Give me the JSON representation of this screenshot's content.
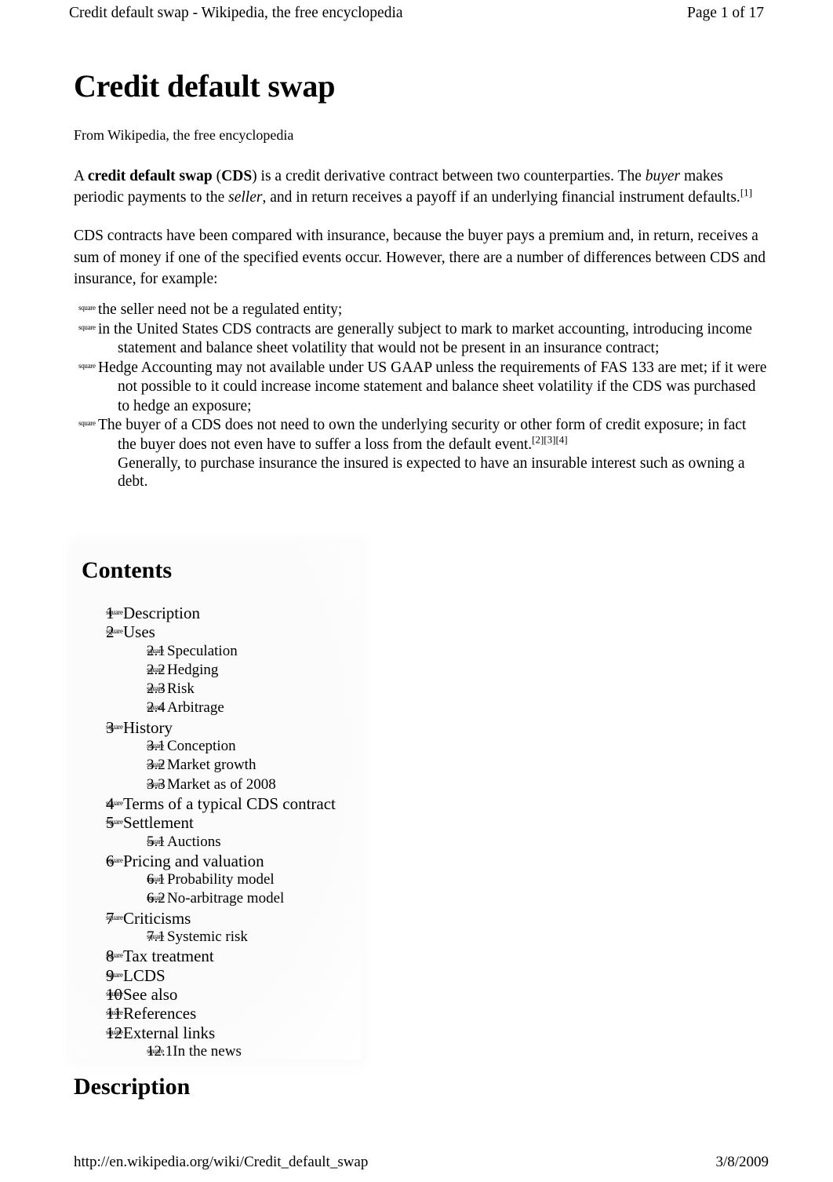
{
  "header": {
    "left": "Credit default swap - Wikipedia, the free encyclopedia",
    "right": "Page 1 of 17"
  },
  "article": {
    "title": "Credit default swap",
    "from_line": "From Wikipedia, the free encyclopedia",
    "paragraph1": {
      "lead_a": "A ",
      "bold_term": "credit default swap",
      "mid1": " (",
      "bold_abbr": "CDS",
      "mid2": ") is a credit derivative contract between two counterparties. The ",
      "italic_buyer": "buyer",
      "mid3": " makes periodic payments to the ",
      "italic_seller": "seller",
      "mid4": ", and in return receives a payoff if an underlying financial instrument defaults.",
      "ref": "[1]"
    },
    "paragraph2": "CDS contracts have been compared with insurance, because the buyer pays a premium and, in return, receives a sum of money if one of the specified events occur. However, there are a number of differences between CDS and insurance, for example:",
    "bullet_marker": "square",
    "bullets": [
      {
        "text": "the seller need not be a regulated entity;"
      },
      {
        "text": "in the United States CDS contracts are generally subject to mark to market accounting, introducing income statement and balance sheet volatility that would not be present in an insurance contract;"
      },
      {
        "text": "Hedge Accounting may not available under US GAAP unless the requirements of FAS 133 are met; if it were not possible to it could increase income statement and balance sheet volatility if the CDS was purchased to hedge an exposure;"
      },
      {
        "text": "The buyer of a CDS does not need to own the underlying security or other form of credit exposure; in fact the buyer does not even have to suffer a loss from the default event.",
        "ref": "[2][3][4]",
        "extra": "Generally, to purchase insurance the insured is expected to have an insurable interest such as owning a debt."
      }
    ]
  },
  "toc": {
    "title": "Contents",
    "marker": "square",
    "entries": [
      {
        "level": 1,
        "number": "1",
        "label": "Description"
      },
      {
        "level": 1,
        "number": "2",
        "label": "Uses"
      },
      {
        "level": 2,
        "number": "2.1",
        "label": "Speculation"
      },
      {
        "level": 2,
        "number": "2.2",
        "label": "Hedging"
      },
      {
        "level": 2,
        "number": "2.3",
        "label": "Risk"
      },
      {
        "level": 2,
        "number": "2.4",
        "label": "Arbitrage"
      },
      {
        "level": 1,
        "number": "3",
        "label": "History"
      },
      {
        "level": 2,
        "number": "3.1",
        "label": "Conception"
      },
      {
        "level": 2,
        "number": "3.2",
        "label": "Market growth"
      },
      {
        "level": 2,
        "number": "3.3",
        "label": "Market as of 2008"
      },
      {
        "level": 1,
        "number": "4",
        "label": "Terms of a typical CDS contract"
      },
      {
        "level": 1,
        "number": "5",
        "label": "Settlement"
      },
      {
        "level": 2,
        "number": "5.1",
        "label": "Auctions"
      },
      {
        "level": 1,
        "number": "6",
        "label": "Pricing and valuation"
      },
      {
        "level": 2,
        "number": "6.1",
        "label": "Probability model"
      },
      {
        "level": 2,
        "number": "6.2",
        "label": "No-arbitrage model"
      },
      {
        "level": 1,
        "number": "7",
        "label": "Criticisms"
      },
      {
        "level": 2,
        "number": "7.1",
        "label": "Systemic risk"
      },
      {
        "level": 1,
        "number": "8",
        "label": "Tax treatment"
      },
      {
        "level": 1,
        "number": "9",
        "label": "LCDS"
      },
      {
        "level": 1,
        "number": "10",
        "label": "See also"
      },
      {
        "level": 1,
        "number": "11",
        "label": "References"
      },
      {
        "level": 1,
        "number": "12",
        "label": "External links"
      },
      {
        "level": 2,
        "number": "12.1",
        "label": "In the news"
      }
    ]
  },
  "section_heading": "Description",
  "footer": {
    "url": "http://en.wikipedia.org/wiki/Credit_default_swap",
    "date": "3/8/2009"
  }
}
